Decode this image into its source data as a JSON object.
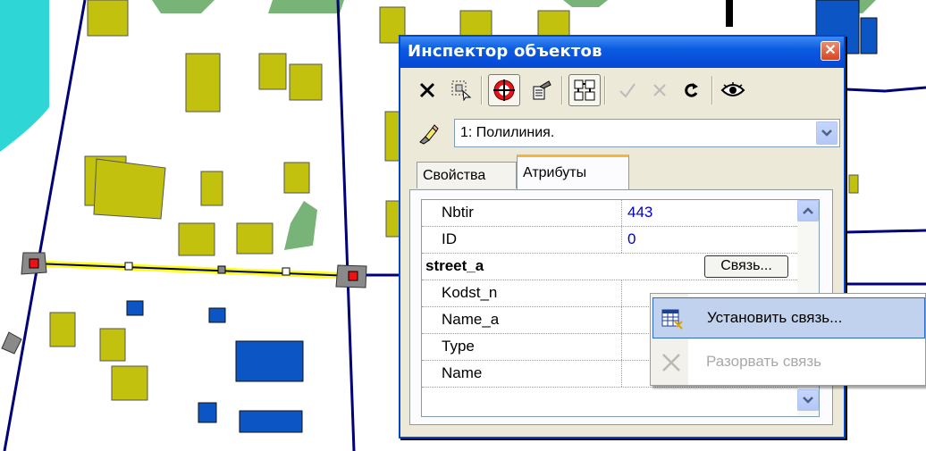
{
  "window": {
    "title": "Инспектор объектов",
    "close_symbol": "✕"
  },
  "toolbar": {
    "buttons": [
      {
        "icon": "delete-x-icon"
      },
      {
        "icon": "select-frame-icon"
      },
      {
        "icon": "target-icon",
        "pressed": true
      },
      {
        "icon": "properties-icon"
      },
      {
        "icon": "tree-structure-icon",
        "pressed": true
      },
      {
        "icon": "apply-check-icon",
        "disabled": true
      },
      {
        "icon": "cancel-x-icon",
        "disabled": true
      },
      {
        "icon": "refresh-icon"
      },
      {
        "icon": "eye-icon"
      }
    ]
  },
  "object_select": {
    "value": "1: Полилиния."
  },
  "tabs": [
    {
      "label": "Свойства",
      "active": false
    },
    {
      "label": "Атрибуты",
      "active": true
    }
  ],
  "attributes": {
    "rows": [
      {
        "name": "Nbtir",
        "value": "443"
      },
      {
        "name": "ID",
        "value": "0"
      },
      {
        "name": "street_a",
        "group": true,
        "button": "Связь..."
      },
      {
        "name": "Kodst_n",
        "value": ""
      },
      {
        "name": "Name_a",
        "value": ""
      },
      {
        "name": "Type",
        "value": ""
      },
      {
        "name": "Name",
        "value": ""
      }
    ]
  },
  "context_menu": {
    "items": [
      {
        "label": "Установить связь...",
        "icon": "link-table-icon",
        "highlighted": true,
        "disabled": false
      },
      {
        "label": "Разорвать связь",
        "icon": "break-link-icon",
        "highlighted": false,
        "disabled": true
      }
    ]
  },
  "colors": {
    "building_olive": "#c2c10d",
    "building_blue": "#0b55c4",
    "vegetation_green": "#78b478",
    "water_cyan": "#2fd6d6",
    "road_line": "#000078",
    "selection_yellow": "#ffff00",
    "vertex_red": "#ee1111"
  }
}
